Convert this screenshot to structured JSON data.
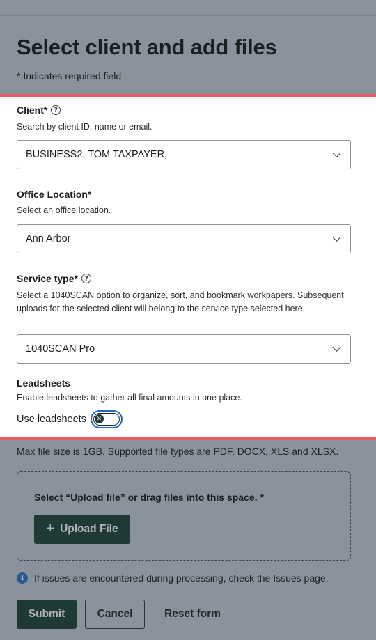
{
  "page": {
    "title": "Select client and add files",
    "required_note": "* Indicates required field"
  },
  "client": {
    "label": "Client*",
    "help": "Search by client ID, name or email.",
    "value": "BUSINESS2, TOM TAXPAYER,"
  },
  "office": {
    "label": "Office Location*",
    "help": "Select an office location.",
    "value": "Ann Arbor"
  },
  "service": {
    "label": "Service type*",
    "help": "Select a 1040SCAN option to organize, sort, and bookmark workpapers. Subsequent uploads for the selected client will belong to the service type selected here.",
    "value": "1040SCAN Pro"
  },
  "leadsheets": {
    "heading": "Leadsheets",
    "help": "Enable leadsheets to gather all final amounts in one place.",
    "toggle_label": "Use leadsheets",
    "toggle_state": "off"
  },
  "upload": {
    "file_note": "Max file size is 1GB. Supported file types are PDF, DOCX, XLS and XLSX.",
    "drop_title": "Select “Upload file” or drag files into this space. *",
    "upload_button": "Upload File"
  },
  "info": {
    "text": "If issues are encountered during processing, check the Issues page."
  },
  "actions": {
    "submit": "Submit",
    "cancel": "Cancel",
    "reset": "Reset form"
  },
  "colors": {
    "overlay": "#8a939b",
    "highlight": "#e85d63",
    "primary": "#1f3a34",
    "focus": "#1f6dba"
  },
  "icons": {
    "help": "question-circle-icon",
    "dropdown": "chevron-down-icon",
    "toggle_off": "x-icon",
    "plus": "plus-icon",
    "info": "info-icon"
  }
}
